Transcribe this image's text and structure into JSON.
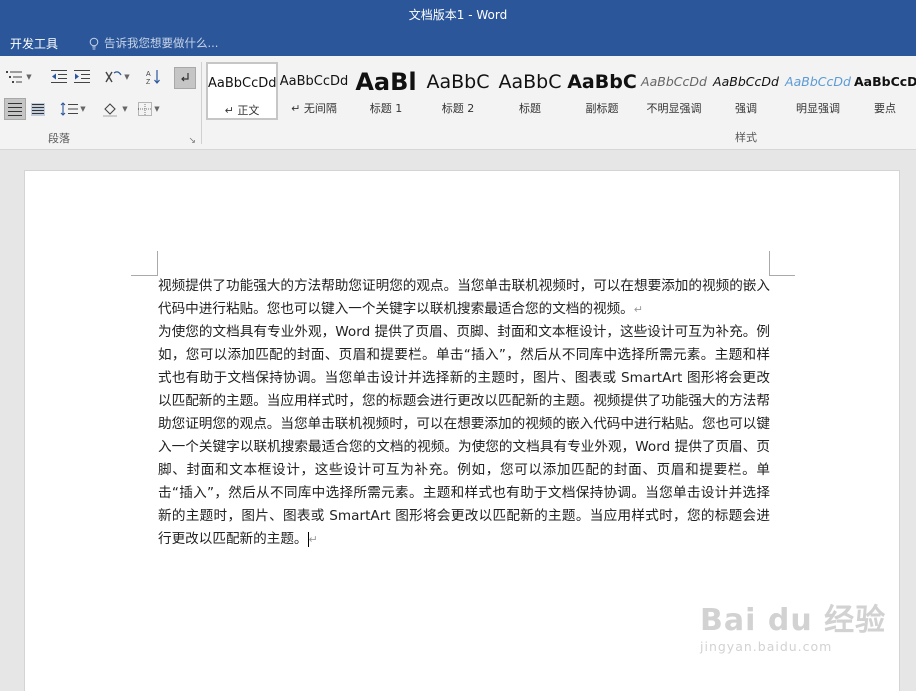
{
  "window": {
    "title": "文档版本1 - Word"
  },
  "tabs": {
    "active": "开发工具",
    "tell_me": "告诉我您想要做什么..."
  },
  "ribbon": {
    "paragraph_group": "段落",
    "styles_group": "样式",
    "styles": [
      {
        "sample": "AaBbCcDd",
        "name": "正文",
        "prefix": "↵",
        "selected": true
      },
      {
        "sample": "AaBbCcDd",
        "name": "无间隔",
        "prefix": "↵"
      },
      {
        "sample": "AaBl",
        "name": "标题 1"
      },
      {
        "sample": "AaBbC",
        "name": "标题 2"
      },
      {
        "sample": "AaBbC",
        "name": "标题"
      },
      {
        "sample": "AaBbC",
        "name": "副标题"
      },
      {
        "sample": "AaBbCcDd",
        "name": "不明显强调"
      },
      {
        "sample": "AaBbCcDd",
        "name": "强调"
      },
      {
        "sample": "AaBbCcDd",
        "name": "明显强调"
      },
      {
        "sample": "AaBbCcD",
        "name": "要点"
      }
    ]
  },
  "document": {
    "paragraphs": [
      "视频提供了功能强大的方法帮助您证明您的观点。当您单击联机视频时，可以在想要添加的视频的嵌入代码中进行粘贴。您也可以键入一个关键字以联机搜索最适合您的文档的视频。",
      "为使您的文档具有专业外观，Word 提供了页眉、页脚、封面和文本框设计，这些设计可互为补充。例如，您可以添加匹配的封面、页眉和提要栏。单击“插入”，然后从不同库中选择所需元素。主题和样式也有助于文档保持协调。当您单击设计并选择新的主题时，图片、图表或 SmartArt 图形将会更改以匹配新的主题。当应用样式时，您的标题会进行更改以匹配新的主题。视频提供了功能强大的方法帮助您证明您的观点。当您单击联机视频时，可以在想要添加的视频的嵌入代码中进行粘贴。您也可以键入一个关键字以联机搜索最适合您的文档的视频。为使您的文档具有专业外观，Word 提供了页眉、页脚、封面和文本框设计，这些设计可互为补充。例如，您可以添加匹配的封面、页眉和提要栏。单击“插入”，然后从不同库中选择所需元素。主题和样式也有助于文档保持协调。当您单击设计并选择新的主题时，图片、图表或 SmartArt 图形将会更改以匹配新的主题。当应用样式时，您的标题会进行更改以匹配新的主题。"
    ],
    "para_mark": "↵"
  },
  "watermark": {
    "brand": "Bai du 经验",
    "url": "jingyan.baidu.com"
  },
  "colors": {
    "title_bar": "#2b579a",
    "ribbon": "#f3f3f3",
    "canvas": "#e6e6e6"
  }
}
